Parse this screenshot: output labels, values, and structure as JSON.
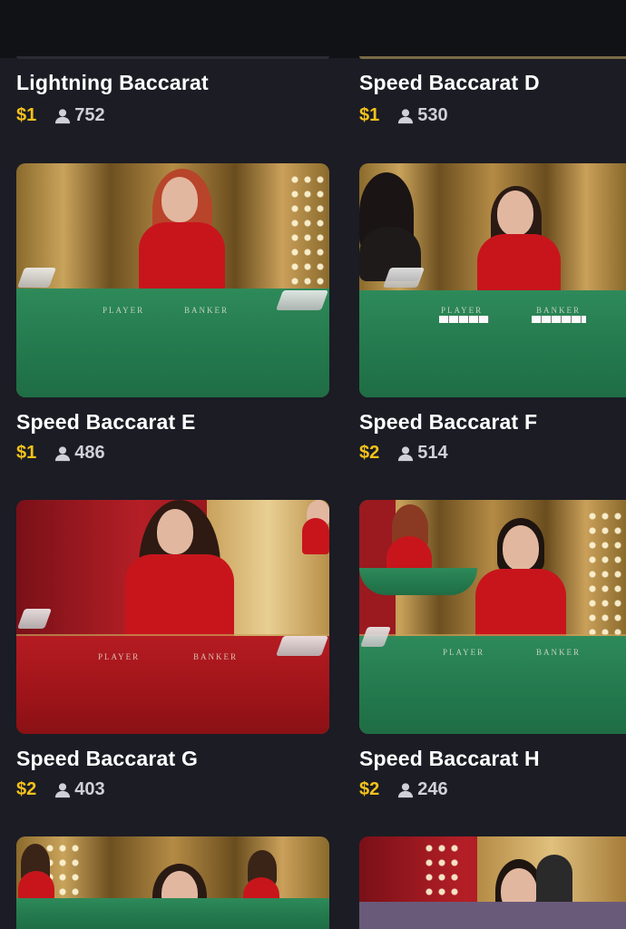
{
  "games": [
    {
      "title": "Lightning Baccarat",
      "price": "$1",
      "players": "752"
    },
    {
      "title": "Speed Baccarat D",
      "price": "$1",
      "players": "530"
    },
    {
      "title": "Speed Baccarat E",
      "price": "$1",
      "players": "486"
    },
    {
      "title": "Speed Baccarat F",
      "price": "$2",
      "players": "514"
    },
    {
      "title": "Speed Baccarat G",
      "price": "$2",
      "players": "403"
    },
    {
      "title": "Speed Baccarat H",
      "price": "$2",
      "players": "246"
    }
  ],
  "table_labels": {
    "player": "PLAYER",
    "banker": "BANKER"
  },
  "icons": {
    "players": "user-icon"
  },
  "colors": {
    "price": "#f4c21a",
    "background": "#1b1c24",
    "felt_green": "#23784c",
    "felt_red": "#9e1419"
  }
}
